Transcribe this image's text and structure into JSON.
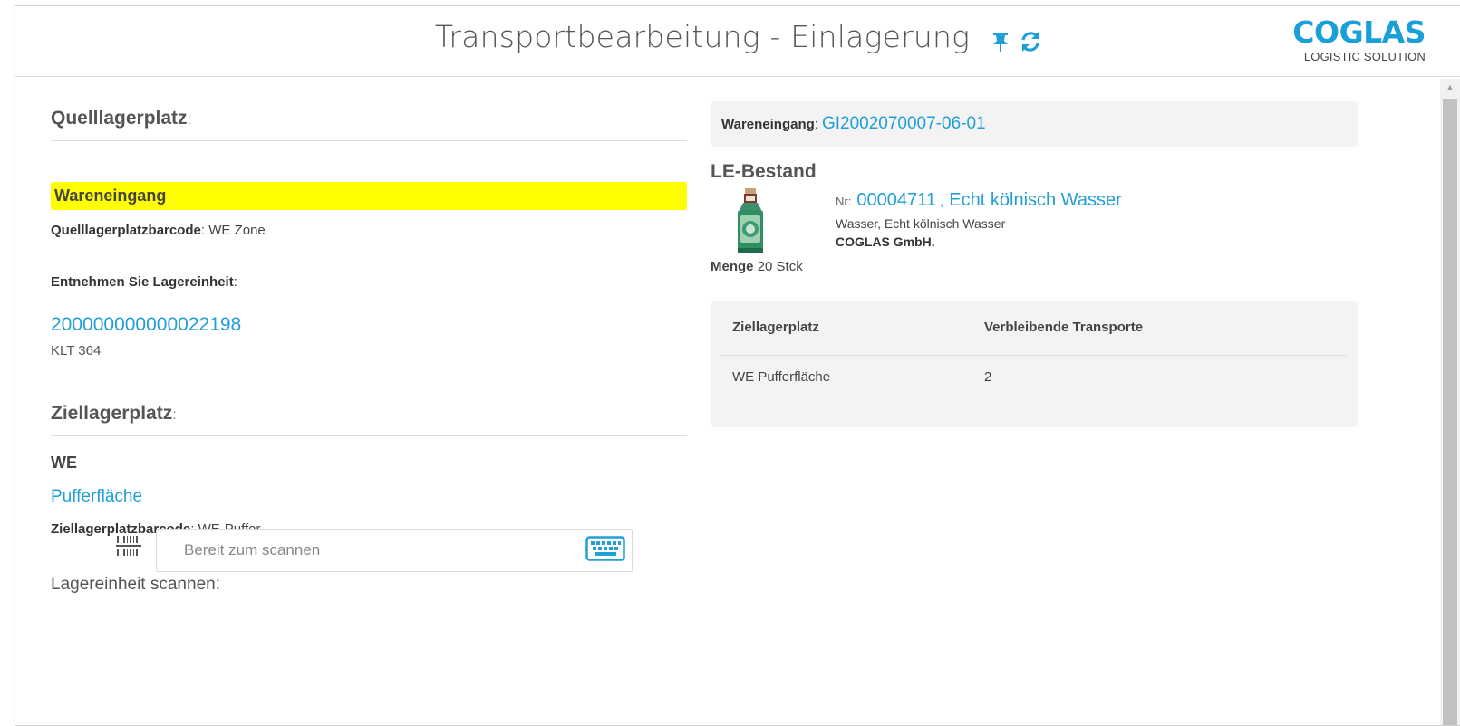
{
  "header": {
    "title": "Transportbearbeitung - Einlagerung",
    "icons": [
      "pin-icon",
      "refresh-icon"
    ],
    "logo": {
      "main": "COGLAS",
      "sub": "LOGISTIC SOLUTION"
    }
  },
  "source": {
    "title": "Quelllagerplatz",
    "colon": ":",
    "highlight": "Wareneingang",
    "barcode_label": "Quelllagerplatzbarcode",
    "barcode_value": "WE Zone",
    "take_label": "Entnehmen Sie Lagereinheit",
    "unit_id": "200000000000022198",
    "unit_type": "KLT 364"
  },
  "target": {
    "title": "Ziellagerplatz",
    "colon": ":",
    "area": "WE",
    "place": "Pufferfläche",
    "barcode_label": "Ziellagerplatzbarcode",
    "barcode_value": "WE-Puffer"
  },
  "scan": {
    "label": "Lagereinheit scannen",
    "colon": ":",
    "placeholder": "Bereit zum scannen"
  },
  "goods_receipt": {
    "label": "Wareneingang",
    "colon": ":",
    "value": "GI2002070007-06-01"
  },
  "stock": {
    "title": "LE-Bestand",
    "nr_label": "Nr:",
    "nr": "00004711",
    "sep": ",",
    "product_name": "Echt kölnisch Wasser",
    "description": "Wasser, Echt kölnisch Wasser",
    "manufacturer": "COGLAS GmbH.",
    "menge_label": "Menge",
    "menge_value": "20 Stck"
  },
  "transport_table": {
    "columns": [
      "Ziellagerplatz",
      "Verbleibende Transporte"
    ],
    "rows": [
      [
        "WE Pufferfläche",
        "2"
      ]
    ]
  },
  "colors": {
    "accent": "#1f9fd6",
    "highlight": "#ffff00",
    "logo": "#1aa0d8"
  }
}
